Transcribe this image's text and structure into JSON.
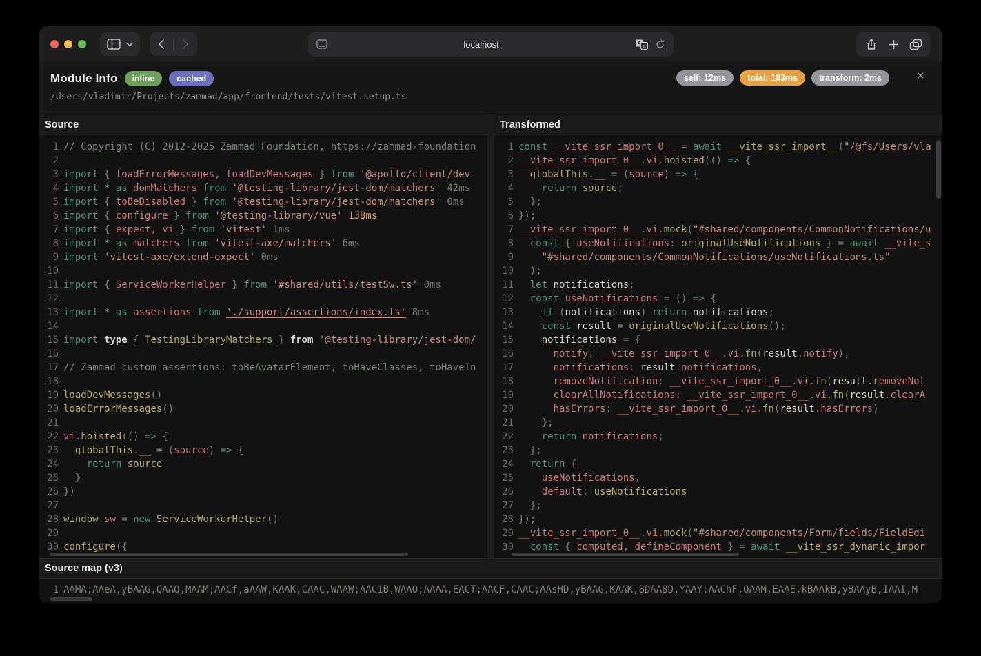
{
  "browser": {
    "url": "localhost",
    "traffic_lights": [
      "close",
      "minimize",
      "zoom"
    ]
  },
  "header": {
    "title": "Module Info",
    "badges": [
      {
        "label": "inline",
        "color": "#6e9f5e"
      },
      {
        "label": "cached",
        "color": "#6a6fc0"
      }
    ],
    "file_path": "/Users/vladimir/Projects/zammad/app/frontend/tests/vitest.setup.ts",
    "timings": [
      {
        "label": "self: 12ms",
        "hot": false
      },
      {
        "label": "total: 193ms",
        "hot": true
      },
      {
        "label": "transform: 2ms",
        "hot": false
      }
    ],
    "close_glyph": "×"
  },
  "colors": {
    "timing_hot_badge": "#e9a23f",
    "timing_gray_badge": "#95959d",
    "syntax": {
      "keyword": "#4d9375",
      "variable": "#cb7676",
      "function": "#b8a965",
      "string": "#c98a7d",
      "constant": "#c99076",
      "punctuation": "#857f76",
      "comment": "#758575",
      "default": "#d8d4c5",
      "time": "#7d786f",
      "time_hot": "#dfa24c"
    }
  },
  "panels": {
    "source": {
      "title": "Source",
      "lines": [
        [
          [
            "c",
            "// Copyright (C) 2012-2025 Zammad Foundation, https://zammad-foundation"
          ]
        ],
        [],
        [
          [
            "k",
            "import "
          ],
          [
            "p",
            "{ "
          ],
          [
            "v",
            "loadErrorMessages"
          ],
          [
            "p",
            ", "
          ],
          [
            "v",
            "loadDevMessages"
          ],
          [
            "p",
            " } "
          ],
          [
            "k",
            "from "
          ],
          [
            "s",
            "'@apollo/client/dev"
          ]
        ],
        [
          [
            "k",
            "import * as "
          ],
          [
            "v",
            "domMatchers"
          ],
          [
            "k",
            " from "
          ],
          [
            "s",
            "'@testing-library/jest-dom/matchers'"
          ],
          [
            "t",
            " 42ms"
          ]
        ],
        [
          [
            "k",
            "import "
          ],
          [
            "p",
            "{ "
          ],
          [
            "v",
            "toBeDisabled"
          ],
          [
            "p",
            " } "
          ],
          [
            "k",
            "from "
          ],
          [
            "s",
            "'@testing-library/jest-dom/matchers'"
          ],
          [
            "t",
            " 0ms"
          ]
        ],
        [
          [
            "k",
            "import "
          ],
          [
            "p",
            "{ "
          ],
          [
            "v",
            "configure"
          ],
          [
            "p",
            " } "
          ],
          [
            "k",
            "from "
          ],
          [
            "s",
            "'@testing-library/vue'"
          ],
          [
            "th",
            " 138ms"
          ]
        ],
        [
          [
            "k",
            "import "
          ],
          [
            "p",
            "{ "
          ],
          [
            "v",
            "expect"
          ],
          [
            "p",
            ", "
          ],
          [
            "v",
            "vi"
          ],
          [
            "p",
            " } "
          ],
          [
            "k",
            "from "
          ],
          [
            "s",
            "'vitest'"
          ],
          [
            "t",
            " 1ms"
          ]
        ],
        [
          [
            "k",
            "import * as "
          ],
          [
            "v",
            "matchers"
          ],
          [
            "k",
            " from "
          ],
          [
            "s",
            "'vitest-axe/matchers'"
          ],
          [
            "t",
            " 6ms"
          ]
        ],
        [
          [
            "k",
            "import "
          ],
          [
            "s",
            "'vitest-axe/extend-expect'"
          ],
          [
            "t",
            " 0ms"
          ]
        ],
        [],
        [
          [
            "k",
            "import "
          ],
          [
            "p",
            "{ "
          ],
          [
            "v",
            "ServiceWorkerHelper"
          ],
          [
            "p",
            " } "
          ],
          [
            "k",
            "from "
          ],
          [
            "s",
            "'#shared/utils/testSw.ts'"
          ],
          [
            "t",
            " 0ms"
          ]
        ],
        [],
        [
          [
            "k",
            "import * as "
          ],
          [
            "v",
            "assertions"
          ],
          [
            "k",
            " from "
          ],
          [
            "u",
            "'./support/assertions/index.ts'"
          ],
          [
            "t",
            " 8ms"
          ]
        ],
        [],
        [
          [
            "k",
            "import "
          ],
          [
            "db",
            "type "
          ],
          [
            "p",
            "{ "
          ],
          [
            "f",
            "TestingLibraryMatchers"
          ],
          [
            "p",
            " } "
          ],
          [
            "db",
            "from "
          ],
          [
            "s",
            "'@testing-library/jest-dom/"
          ]
        ],
        [],
        [
          [
            "c",
            "// Zammad custom assertions: toBeAvatarElement, toHaveClasses, toHaveIn"
          ]
        ],
        [],
        [
          [
            "f",
            "loadDevMessages"
          ],
          [
            "p",
            "()"
          ]
        ],
        [
          [
            "f",
            "loadErrorMessages"
          ],
          [
            "p",
            "()"
          ]
        ],
        [],
        [
          [
            "v",
            "vi"
          ],
          [
            "p",
            "."
          ],
          [
            "f",
            "hoisted"
          ],
          [
            "p",
            "(() "
          ],
          [
            "k",
            "=> "
          ],
          [
            "p",
            "{"
          ]
        ],
        [
          [
            "d",
            "  "
          ],
          [
            "f",
            "globalThis"
          ],
          [
            "p",
            "."
          ],
          [
            "o",
            "__"
          ],
          [
            "p",
            " = ("
          ],
          [
            "v",
            "source"
          ],
          [
            "p",
            ") "
          ],
          [
            "k",
            "=> "
          ],
          [
            "p",
            "{"
          ]
        ],
        [
          [
            "d",
            "    "
          ],
          [
            "k",
            "return "
          ],
          [
            "f",
            "source"
          ]
        ],
        [
          [
            "p",
            "  }"
          ]
        ],
        [
          [
            "p",
            "})"
          ]
        ],
        [],
        [
          [
            "f",
            "window"
          ],
          [
            "p",
            "."
          ],
          [
            "v",
            "sw"
          ],
          [
            "p",
            " = "
          ],
          [
            "k",
            "new "
          ],
          [
            "f",
            "ServiceWorkerHelper"
          ],
          [
            "p",
            "()"
          ]
        ],
        [],
        [
          [
            "f",
            "configure"
          ],
          [
            "p",
            "({"
          ]
        ]
      ]
    },
    "transformed": {
      "title": "Transformed",
      "lines": [
        [
          [
            "k",
            "const "
          ],
          [
            "v",
            "__vite_ssr_import_0__"
          ],
          [
            "p",
            " = "
          ],
          [
            "k",
            "await "
          ],
          [
            "f",
            "__vite_ssr_import__"
          ],
          [
            "p",
            "("
          ],
          [
            "s",
            "\"/@fs/Users/vla"
          ]
        ],
        [
          [
            "v",
            "__vite_ssr_import_0__"
          ],
          [
            "p",
            "."
          ],
          [
            "v",
            "vi"
          ],
          [
            "p",
            "."
          ],
          [
            "f",
            "hoisted"
          ],
          [
            "p",
            "(() "
          ],
          [
            "k",
            "=> "
          ],
          [
            "p",
            "{"
          ]
        ],
        [
          [
            "d",
            "  "
          ],
          [
            "f",
            "globalThis"
          ],
          [
            "p",
            "."
          ],
          [
            "o",
            "__"
          ],
          [
            "p",
            " = ("
          ],
          [
            "v",
            "source"
          ],
          [
            "p",
            ") "
          ],
          [
            "k",
            "=> "
          ],
          [
            "p",
            "{"
          ]
        ],
        [
          [
            "d",
            "    "
          ],
          [
            "k",
            "return "
          ],
          [
            "f",
            "source"
          ],
          [
            "p",
            ";"
          ]
        ],
        [
          [
            "p",
            "  };"
          ]
        ],
        [
          [
            "p",
            "});"
          ]
        ],
        [
          [
            "v",
            "__vite_ssr_import_0__"
          ],
          [
            "p",
            "."
          ],
          [
            "v",
            "vi"
          ],
          [
            "p",
            "."
          ],
          [
            "f",
            "mock"
          ],
          [
            "p",
            "("
          ],
          [
            "s",
            "\"#shared/components/CommonNotifications/u"
          ]
        ],
        [
          [
            "d",
            "  "
          ],
          [
            "k",
            "const "
          ],
          [
            "p",
            "{ "
          ],
          [
            "v",
            "useNotifications"
          ],
          [
            "p",
            ": "
          ],
          [
            "f",
            "originalUseNotifications"
          ],
          [
            "p",
            " } = "
          ],
          [
            "k",
            "await "
          ],
          [
            "v",
            "__vite_s"
          ]
        ],
        [
          [
            "d",
            "    "
          ],
          [
            "s",
            "\"#shared/components/CommonNotifications/useNotifications.ts\""
          ]
        ],
        [
          [
            "p",
            "  );"
          ]
        ],
        [
          [
            "d",
            "  "
          ],
          [
            "k",
            "let "
          ],
          [
            "d",
            "notifications"
          ],
          [
            "p",
            ";"
          ]
        ],
        [
          [
            "d",
            "  "
          ],
          [
            "k",
            "const "
          ],
          [
            "v",
            "useNotifications"
          ],
          [
            "p",
            " = () "
          ],
          [
            "k",
            "=> "
          ],
          [
            "p",
            "{"
          ]
        ],
        [
          [
            "d",
            "    "
          ],
          [
            "k",
            "if "
          ],
          [
            "p",
            "("
          ],
          [
            "d",
            "notifications"
          ],
          [
            "p",
            ") "
          ],
          [
            "k",
            "return "
          ],
          [
            "d",
            "notifications"
          ],
          [
            "p",
            ";"
          ]
        ],
        [
          [
            "d",
            "    "
          ],
          [
            "k",
            "const "
          ],
          [
            "d",
            "result"
          ],
          [
            "p",
            " = "
          ],
          [
            "f",
            "originalUseNotifications"
          ],
          [
            "p",
            "();"
          ]
        ],
        [
          [
            "d",
            "    notifications"
          ],
          [
            "p",
            " = {"
          ]
        ],
        [
          [
            "d",
            "      "
          ],
          [
            "v",
            "notify"
          ],
          [
            "p",
            ": "
          ],
          [
            "v",
            "__vite_ssr_import_0__"
          ],
          [
            "p",
            "."
          ],
          [
            "v",
            "vi"
          ],
          [
            "p",
            "."
          ],
          [
            "f",
            "fn"
          ],
          [
            "p",
            "("
          ],
          [
            "d",
            "result"
          ],
          [
            "p",
            "."
          ],
          [
            "v",
            "notify"
          ],
          [
            "p",
            "),"
          ]
        ],
        [
          [
            "d",
            "      "
          ],
          [
            "v",
            "notifications"
          ],
          [
            "p",
            ": "
          ],
          [
            "d",
            "result"
          ],
          [
            "p",
            "."
          ],
          [
            "v",
            "notifications"
          ],
          [
            "p",
            ","
          ]
        ],
        [
          [
            "d",
            "      "
          ],
          [
            "v",
            "removeNotification"
          ],
          [
            "p",
            ": "
          ],
          [
            "v",
            "__vite_ssr_import_0__"
          ],
          [
            "p",
            "."
          ],
          [
            "v",
            "vi"
          ],
          [
            "p",
            "."
          ],
          [
            "f",
            "fn"
          ],
          [
            "p",
            "("
          ],
          [
            "d",
            "result"
          ],
          [
            "p",
            "."
          ],
          [
            "v",
            "removeNot"
          ]
        ],
        [
          [
            "d",
            "      "
          ],
          [
            "v",
            "clearAllNotifications"
          ],
          [
            "p",
            ": "
          ],
          [
            "v",
            "__vite_ssr_import_0__"
          ],
          [
            "p",
            "."
          ],
          [
            "v",
            "vi"
          ],
          [
            "p",
            "."
          ],
          [
            "f",
            "fn"
          ],
          [
            "p",
            "("
          ],
          [
            "d",
            "result"
          ],
          [
            "p",
            "."
          ],
          [
            "v",
            "clearA"
          ]
        ],
        [
          [
            "d",
            "      "
          ],
          [
            "v",
            "hasErrors"
          ],
          [
            "p",
            ": "
          ],
          [
            "v",
            "__vite_ssr_import_0__"
          ],
          [
            "p",
            "."
          ],
          [
            "v",
            "vi"
          ],
          [
            "p",
            "."
          ],
          [
            "f",
            "fn"
          ],
          [
            "p",
            "("
          ],
          [
            "d",
            "result"
          ],
          [
            "p",
            "."
          ],
          [
            "v",
            "hasErrors"
          ],
          [
            "p",
            ")"
          ]
        ],
        [
          [
            "p",
            "    };"
          ]
        ],
        [
          [
            "d",
            "    "
          ],
          [
            "k",
            "return "
          ],
          [
            "v",
            "notifications"
          ],
          [
            "p",
            ";"
          ]
        ],
        [
          [
            "p",
            "  };"
          ]
        ],
        [
          [
            "d",
            "  "
          ],
          [
            "k",
            "return "
          ],
          [
            "p",
            "{"
          ]
        ],
        [
          [
            "d",
            "    "
          ],
          [
            "v",
            "useNotifications"
          ],
          [
            "p",
            ","
          ]
        ],
        [
          [
            "d",
            "    "
          ],
          [
            "v",
            "default"
          ],
          [
            "p",
            ": "
          ],
          [
            "f",
            "useNotifications"
          ]
        ],
        [
          [
            "p",
            "  };"
          ]
        ],
        [
          [
            "p",
            "});"
          ]
        ],
        [
          [
            "v",
            "__vite_ssr_import_0__"
          ],
          [
            "p",
            "."
          ],
          [
            "v",
            "vi"
          ],
          [
            "p",
            "."
          ],
          [
            "f",
            "mock"
          ],
          [
            "p",
            "("
          ],
          [
            "s",
            "\"#shared/components/Form/fields/FieldEdi"
          ]
        ],
        [
          [
            "d",
            "  "
          ],
          [
            "k",
            "const "
          ],
          [
            "p",
            "{ "
          ],
          [
            "v",
            "computed"
          ],
          [
            "p",
            ", "
          ],
          [
            "v",
            "defineComponent"
          ],
          [
            "p",
            " } = "
          ],
          [
            "k",
            "await "
          ],
          [
            "f",
            "__vite_ssr_dynamic_impor"
          ]
        ]
      ]
    }
  },
  "sourcemap": {
    "title": "Source map (v3)",
    "line_number": "1",
    "mappings": "AAMA;AAeA,yBAAG,QAAQ,MAAM;AACf,aAAW,KAAK,CAAC,WAAW;AAC1B,WAAO;AAAA,EACT;AACF,CAAC;AAsHD,yBAAG,KAAK,8DAA8D,YAAY;AAChF,QAAM,EAAE,kBAAkB,yBAAyB,IAAI,M"
  }
}
